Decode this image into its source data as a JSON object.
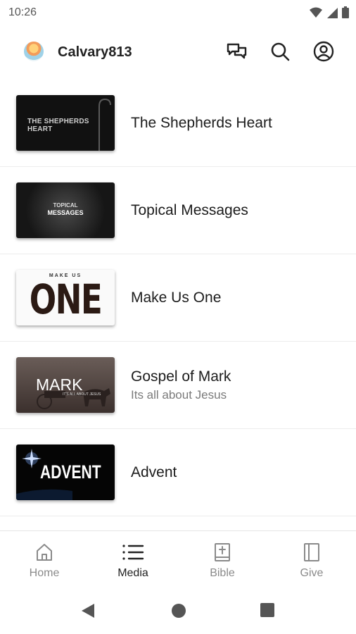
{
  "status_bar": {
    "time": "10:26",
    "icons": [
      "wifi-icon",
      "signal-icon",
      "battery-icon"
    ]
  },
  "app_bar": {
    "title": "Calvary813",
    "actions": [
      "chat-icon",
      "search-icon",
      "account-icon"
    ]
  },
  "items": [
    {
      "title": "The Shepherds Heart",
      "subtitle": "",
      "thumb_text": "THE SHEPHERDS HEART"
    },
    {
      "title": "Topical Messages",
      "subtitle": "",
      "thumb_text": [
        "TOPICAL",
        "MESSAGES"
      ]
    },
    {
      "title": "Make Us One",
      "subtitle": "",
      "thumb_text": [
        "MAKE US",
        "ONE"
      ]
    },
    {
      "title": "Gospel of Mark",
      "subtitle": "Its all about Jesus",
      "thumb_text": [
        "MARK",
        "IT'S ALL ABOUT JESUS"
      ]
    },
    {
      "title": "Advent",
      "subtitle": "",
      "thumb_text": "ADVENT"
    }
  ],
  "bottom_nav": [
    {
      "label": "Home",
      "icon": "home-icon",
      "active": false
    },
    {
      "label": "Media",
      "icon": "list-icon",
      "active": true
    },
    {
      "label": "Bible",
      "icon": "bible-icon",
      "active": false
    },
    {
      "label": "Give",
      "icon": "book-icon",
      "active": false
    }
  ],
  "colors": {
    "text": "#1c1c1c",
    "secondary": "#7a7a7a",
    "inactive": "#8a8a8a",
    "divider": "#ececec"
  }
}
